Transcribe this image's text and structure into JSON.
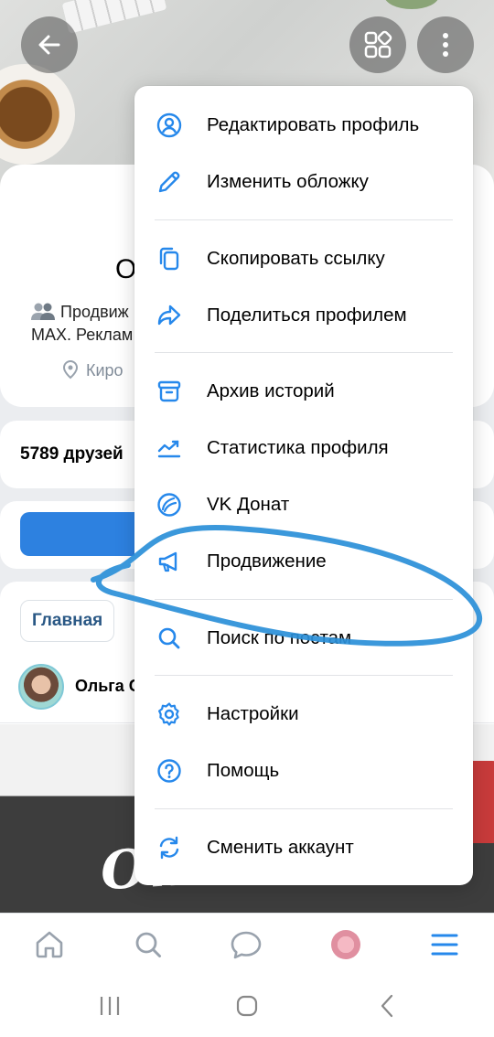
{
  "profile": {
    "name_partial": "О",
    "status_line1": "Продвиж",
    "status_line2": "MAX. Реклам",
    "location": "Киро",
    "friends": "5789 друзей",
    "tab_main": "Главная",
    "post_author": "Ольга С",
    "post_image_text": "Отзывы"
  },
  "header": {
    "back_icon": "arrow-left-icon",
    "apps_icon": "apps-grid-icon",
    "more_icon": "more-vertical-icon"
  },
  "menu": {
    "items": [
      {
        "label": "Редактировать профиль",
        "icon": "user-circle-icon"
      },
      {
        "label": "Изменить обложку",
        "icon": "pencil-icon"
      },
      {
        "label": "Скопировать ссылку",
        "icon": "copy-icon"
      },
      {
        "label": "Поделиться профилем",
        "icon": "share-icon"
      },
      {
        "label": "Архив историй",
        "icon": "archive-icon"
      },
      {
        "label": "Статистика профиля",
        "icon": "statistics-icon"
      },
      {
        "label": "VK Донат",
        "icon": "vk-donut-icon"
      },
      {
        "label": "Продвижение",
        "icon": "megaphone-icon"
      },
      {
        "label": "Поиск по постам",
        "icon": "search-icon"
      },
      {
        "label": "Настройки",
        "icon": "gear-icon"
      },
      {
        "label": "Помощь",
        "icon": "help-icon"
      },
      {
        "label": "Сменить аккаунт",
        "icon": "switch-account-icon"
      }
    ]
  },
  "bottom_nav": {
    "items": [
      "home-icon",
      "search-icon",
      "messages-icon",
      "profile-avatar",
      "menu-icon"
    ]
  },
  "colors": {
    "accent": "#2d81e0",
    "icon": "#2688eb",
    "scribble": "#2a8fd8"
  }
}
